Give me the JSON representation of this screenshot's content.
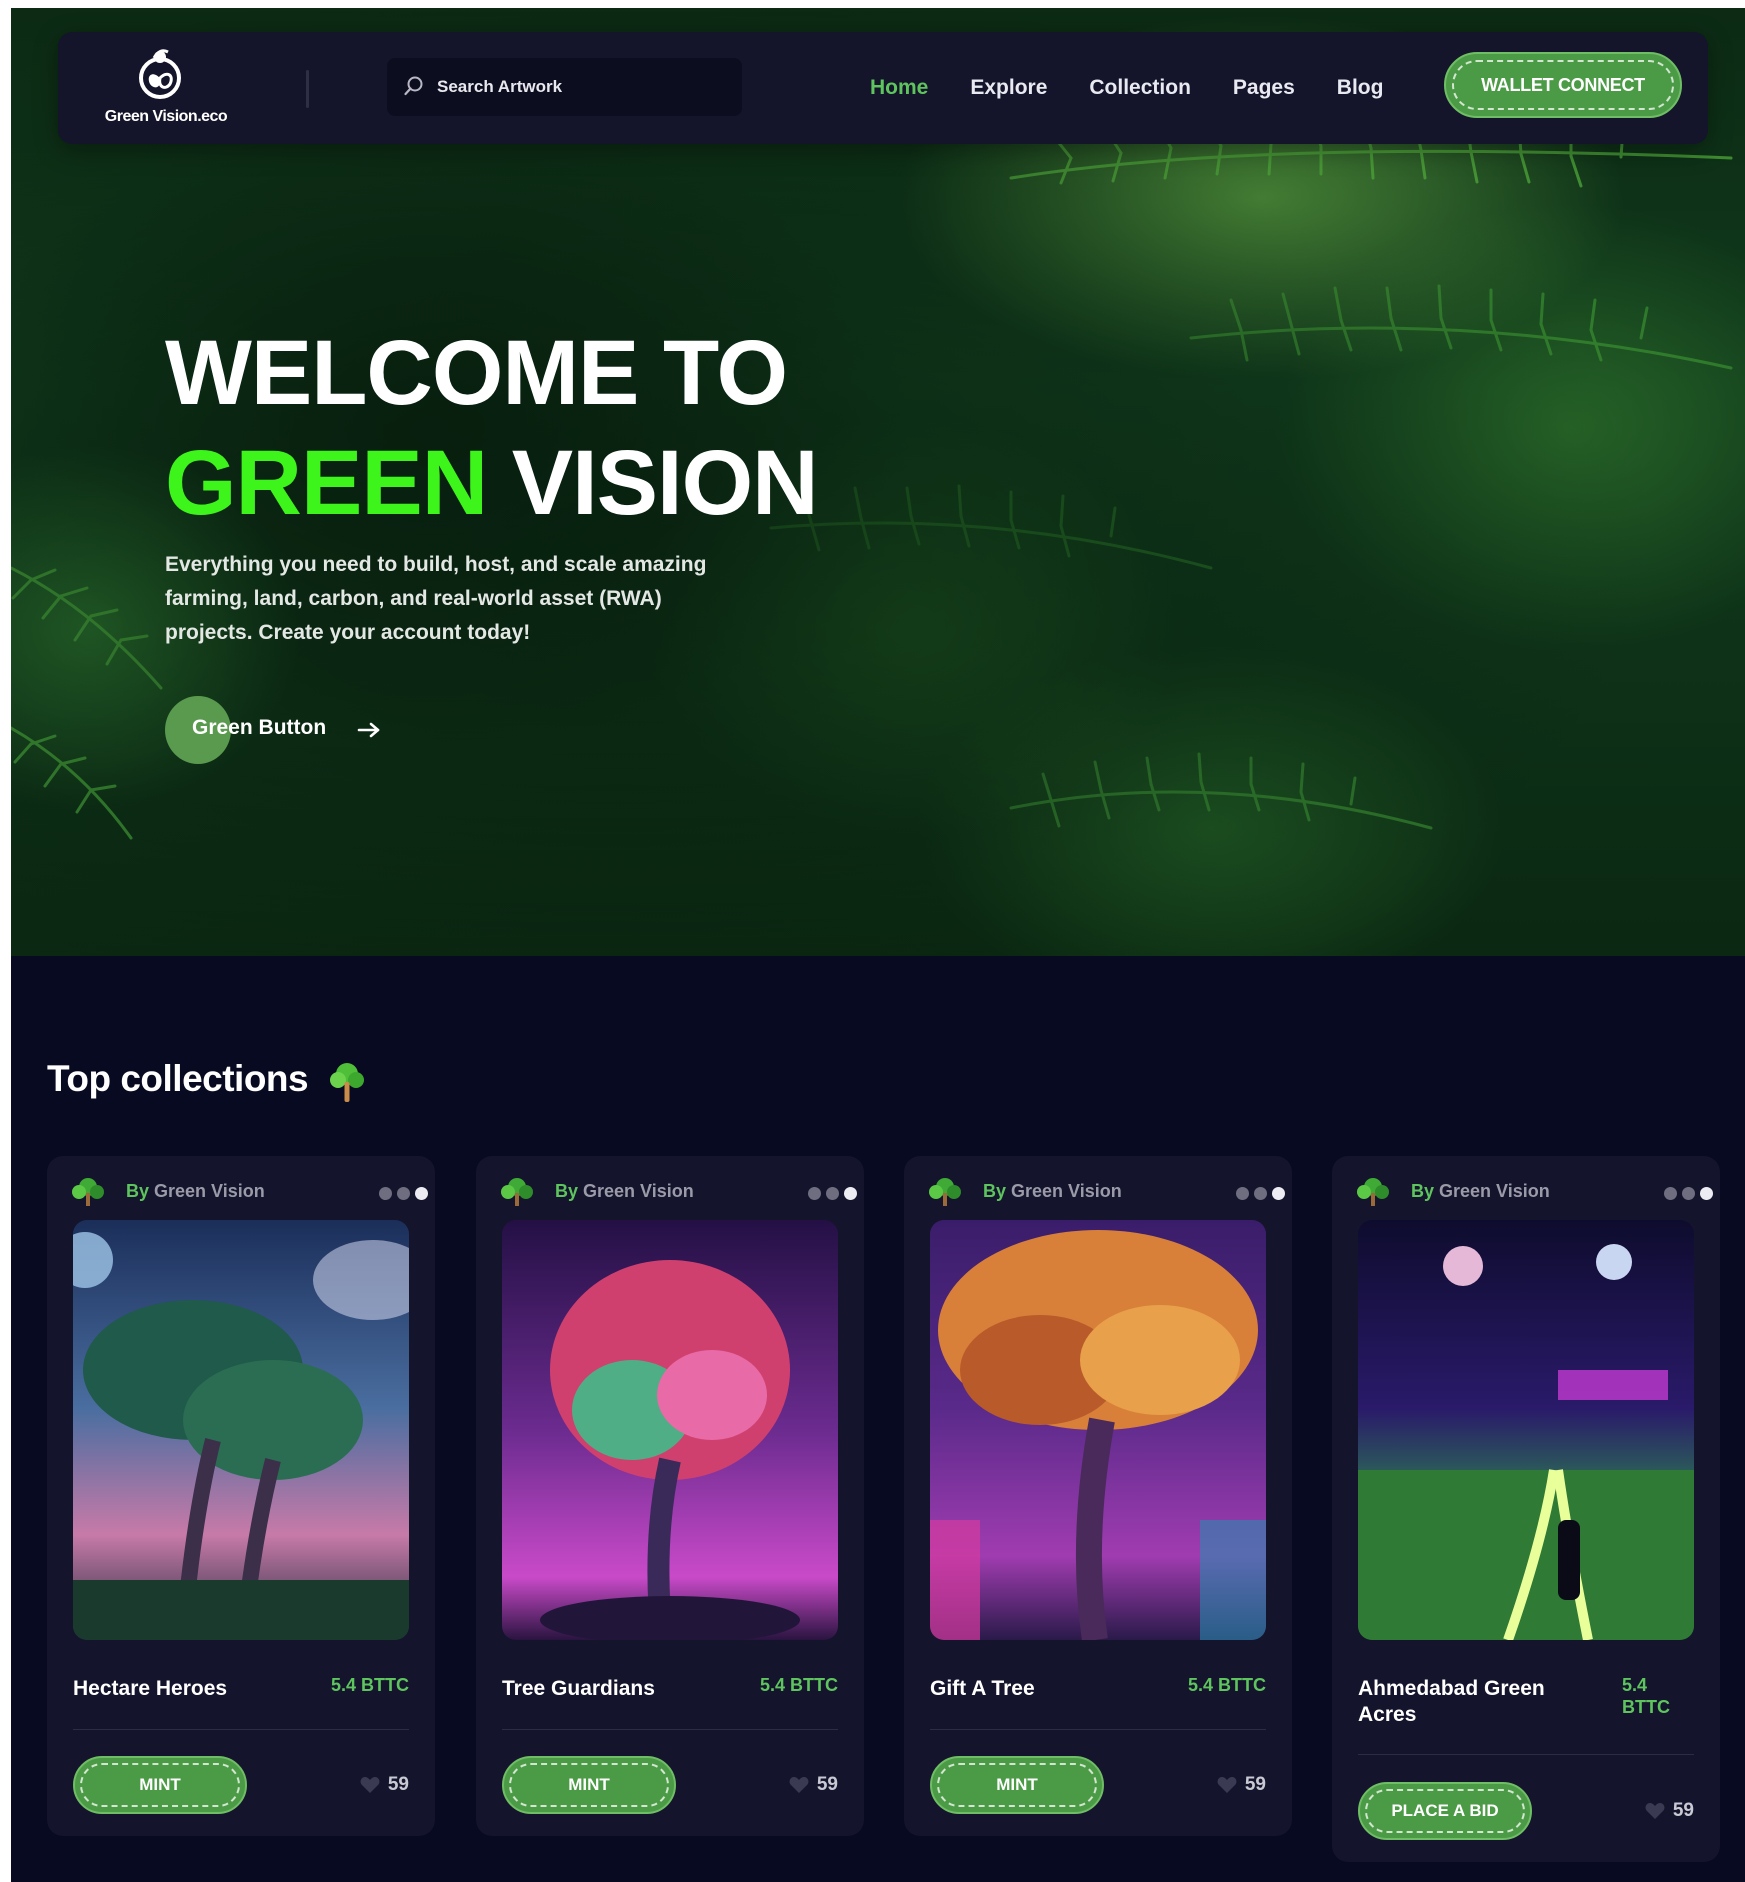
{
  "brand": {
    "name": "Green Vision.eco"
  },
  "search": {
    "placeholder": "Search Artwork"
  },
  "nav": {
    "links": [
      {
        "label": "Home",
        "active": true
      },
      {
        "label": "Explore",
        "active": false
      },
      {
        "label": "Collection",
        "active": false
      },
      {
        "label": "Pages",
        "active": false
      },
      {
        "label": "Blog",
        "active": false
      }
    ],
    "cta_label": "WALLET CONNECT"
  },
  "hero": {
    "title_line1": "WELCOME TO",
    "title_accent": "GREEN",
    "title_line2_rest": "VISION",
    "description": "Everything you need to build, host, and scale amazing farming, land, carbon, and real-world asset (RWA) projects. Create your account today!",
    "button_label": "Green Button"
  },
  "collections": {
    "title": "Top collections",
    "cards": [
      {
        "by": "By",
        "creator": "Green Vision",
        "name": "Hectare Heroes",
        "price": "5.4 BTTC",
        "action": "MINT",
        "likes": "59"
      },
      {
        "by": "By",
        "creator": "Green Vision",
        "name": "Tree Guardians",
        "price": "5.4 BTTC",
        "action": "MINT",
        "likes": "59"
      },
      {
        "by": "By",
        "creator": "Green Vision",
        "name": "Gift A Tree",
        "price": "5.4 BTTC",
        "action": "MINT",
        "likes": "59"
      },
      {
        "by": "By",
        "creator": "Green Vision",
        "name": "Ahmedabad Green Acres",
        "price": "5.4 BTTC",
        "action": "PLACE A BID",
        "likes": "59"
      }
    ]
  },
  "colors": {
    "accent_green": "#5ec45e",
    "title_green": "#3df51a",
    "button_green": "#4b9b46",
    "page_bg": "#070a20",
    "card_bg": "#14142c"
  },
  "icons": [
    "logo-icon",
    "search-icon",
    "arrow-right-icon",
    "tree-icon",
    "more-dots-icon",
    "heart-icon"
  ]
}
